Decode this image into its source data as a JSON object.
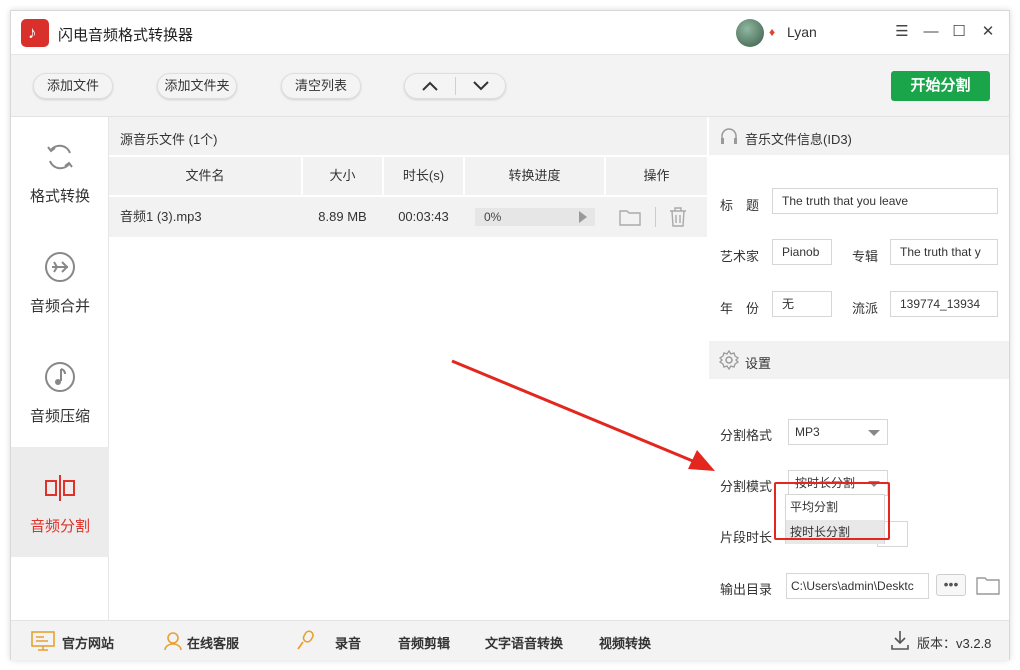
{
  "window": {
    "title": "闪电音频格式转换器",
    "user": "Lyan",
    "controls": {
      "menu": "☰",
      "minimize": "—",
      "maximize": "☐",
      "close": "✕"
    }
  },
  "toolbar": {
    "add_file": "添加文件",
    "add_folder": "添加文件夹",
    "clear_list": "清空列表",
    "move_up": "∧",
    "move_down": "∨",
    "start": "开始分割"
  },
  "sidebar": {
    "items": [
      {
        "label": "格式转换",
        "icon": "refresh-icon"
      },
      {
        "label": "音频合并",
        "icon": "merge-icon"
      },
      {
        "label": "音频压缩",
        "icon": "music-note-icon"
      },
      {
        "label": "音频分割",
        "icon": "split-icon"
      }
    ],
    "active_index": 3
  },
  "file_list": {
    "header": "源音乐文件 (1个)",
    "columns": [
      "文件名",
      "大小",
      "时长(s)",
      "转换进度",
      "操作"
    ],
    "rows": [
      {
        "name": "音频1 (3).mp3",
        "size": "8.89 MB",
        "duration": "00:03:43",
        "progress": "0%"
      }
    ]
  },
  "info": {
    "header": "音乐文件信息(ID3)",
    "title_label": "标　题",
    "title_value": "The truth that you leave",
    "artist_label": "艺术家",
    "artist_value": "Pianob",
    "album_label": "专辑",
    "album_value": "The truth that y",
    "year_label": "年　份",
    "year_value": "无",
    "genre_label": "流派",
    "genre_value": "139774_13934"
  },
  "settings": {
    "header": "设置",
    "format_label": "分割格式",
    "format_value": "MP3",
    "mode_label": "分割模式",
    "mode_value": "按时长分割",
    "mode_options": [
      "平均分割",
      "按时长分割"
    ],
    "segment_label": "片段时长",
    "output_label": "输出目录",
    "output_value": "C:\\Users\\admin\\Desktc",
    "browse": "•••"
  },
  "bottom": {
    "website": "官方网站",
    "support": "在线客服",
    "record": "录音",
    "edit": "音频剪辑",
    "tts": "文字语音转换",
    "video": "视频转换",
    "version": "版本：v3.2.8"
  },
  "colors": {
    "accent_red": "#e0322a",
    "start_green": "#1aa54a",
    "annotation_red": "#e3261e"
  }
}
